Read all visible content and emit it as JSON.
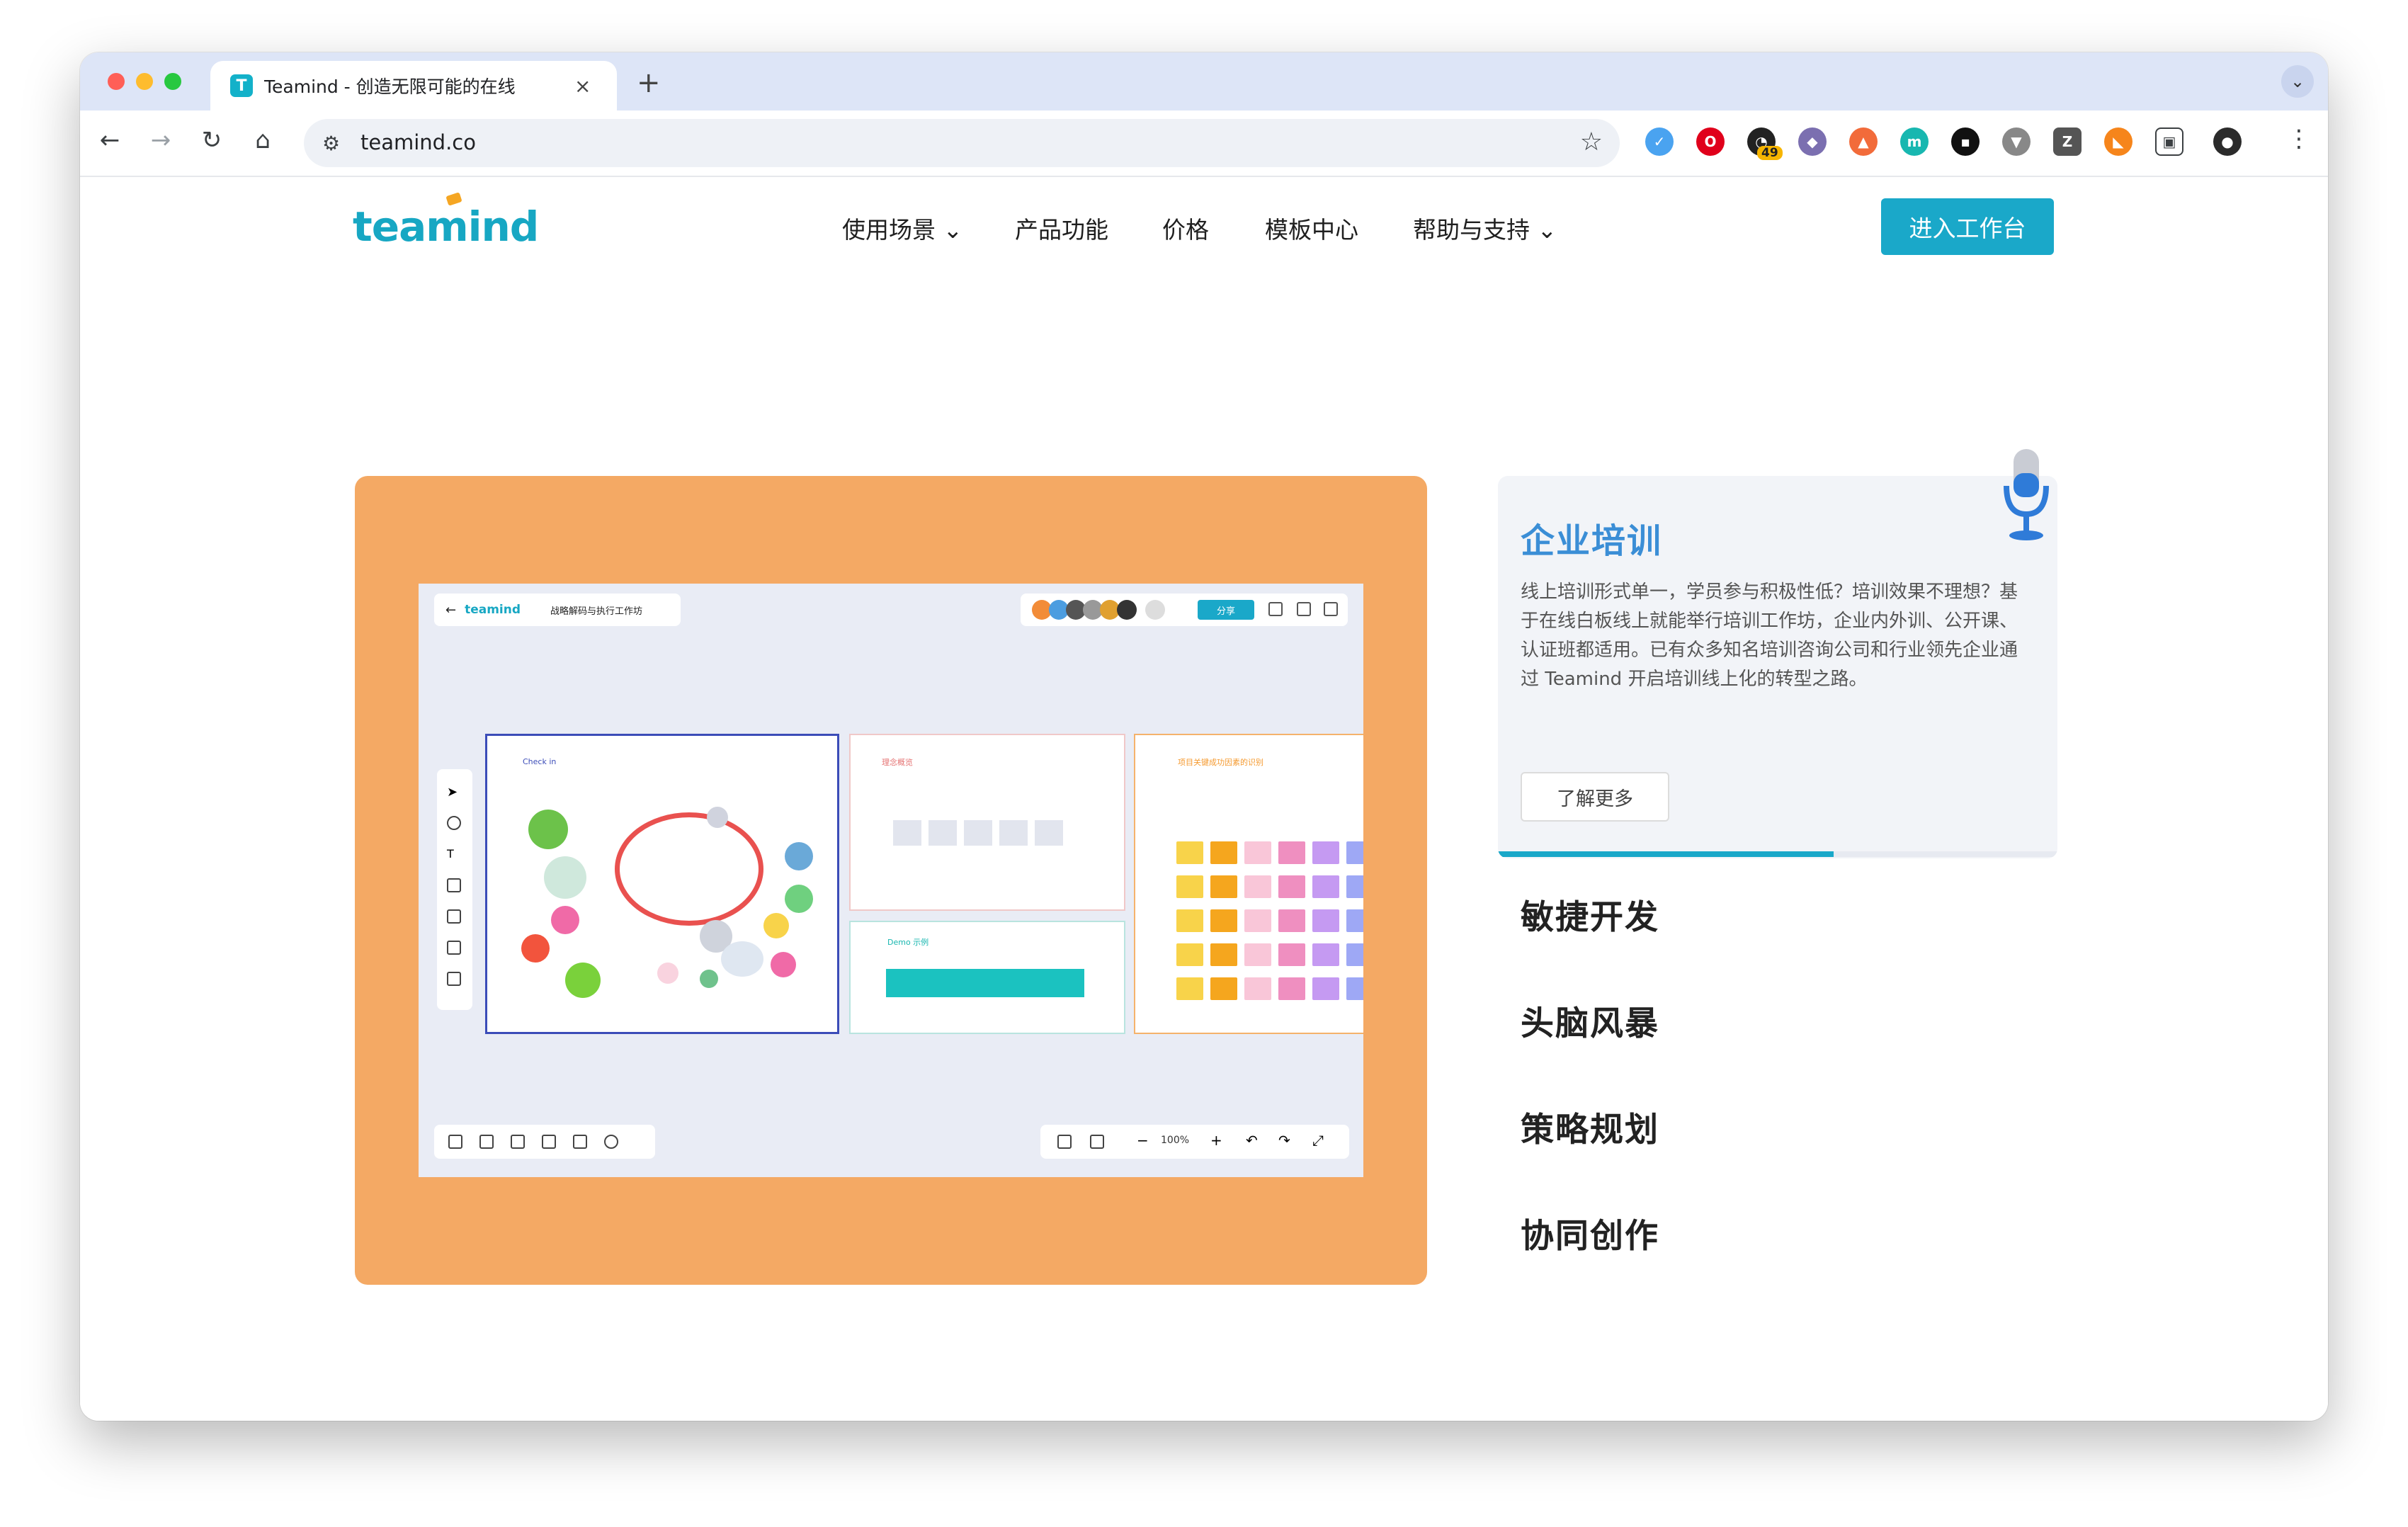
{
  "browser": {
    "tab_title": "Teamind - 创造无限可能的在线",
    "tab_close": "×",
    "new_tab": "+",
    "url": "teamind.co",
    "extension_badge": "49",
    "nav_back": "←",
    "nav_forward": "→",
    "nav_reload": "↻",
    "nav_home": "⌂",
    "star": "☆",
    "menu": "⋮",
    "tab_menu": "⌄"
  },
  "site": {
    "logo": "teamind",
    "nav": [
      {
        "label": "使用场景 ⌄"
      },
      {
        "label": "产品功能"
      },
      {
        "label": "价格"
      },
      {
        "label": "模板中心"
      },
      {
        "label": "帮助与支持 ⌄"
      }
    ],
    "cta": "进入工作台"
  },
  "preview": {
    "board_logo": "teamind",
    "board_title": "战略解码与执行工作坊",
    "share": "分享",
    "frame1_title": "Check in",
    "frame2_title": "理念概览",
    "frame3_title": "项目关键成功因素的识别",
    "frame4_title": "Demo 示例",
    "zoom": "100%"
  },
  "feature": {
    "title": "企业培训",
    "description": "线上培训形式单一，学员参与积极性低？培训效果不理想？基于在线白板线上就能举行培训工作坊，企业内外训、公开课、认证班都适用。已有众多知名培训咨询公司和行业领先企业通过 Teamind 开启培训线上化的转型之路。",
    "learn_more": "了解更多",
    "progress": 0.6
  },
  "scenes": [
    {
      "label": "敏捷开发"
    },
    {
      "label": "头脑风暴"
    },
    {
      "label": "策略规划"
    },
    {
      "label": "协同创作"
    }
  ],
  "colors": {
    "brand": "#1aa8c9",
    "card_orange": "#f4a964",
    "feature_blue": "#3b8ed6"
  }
}
